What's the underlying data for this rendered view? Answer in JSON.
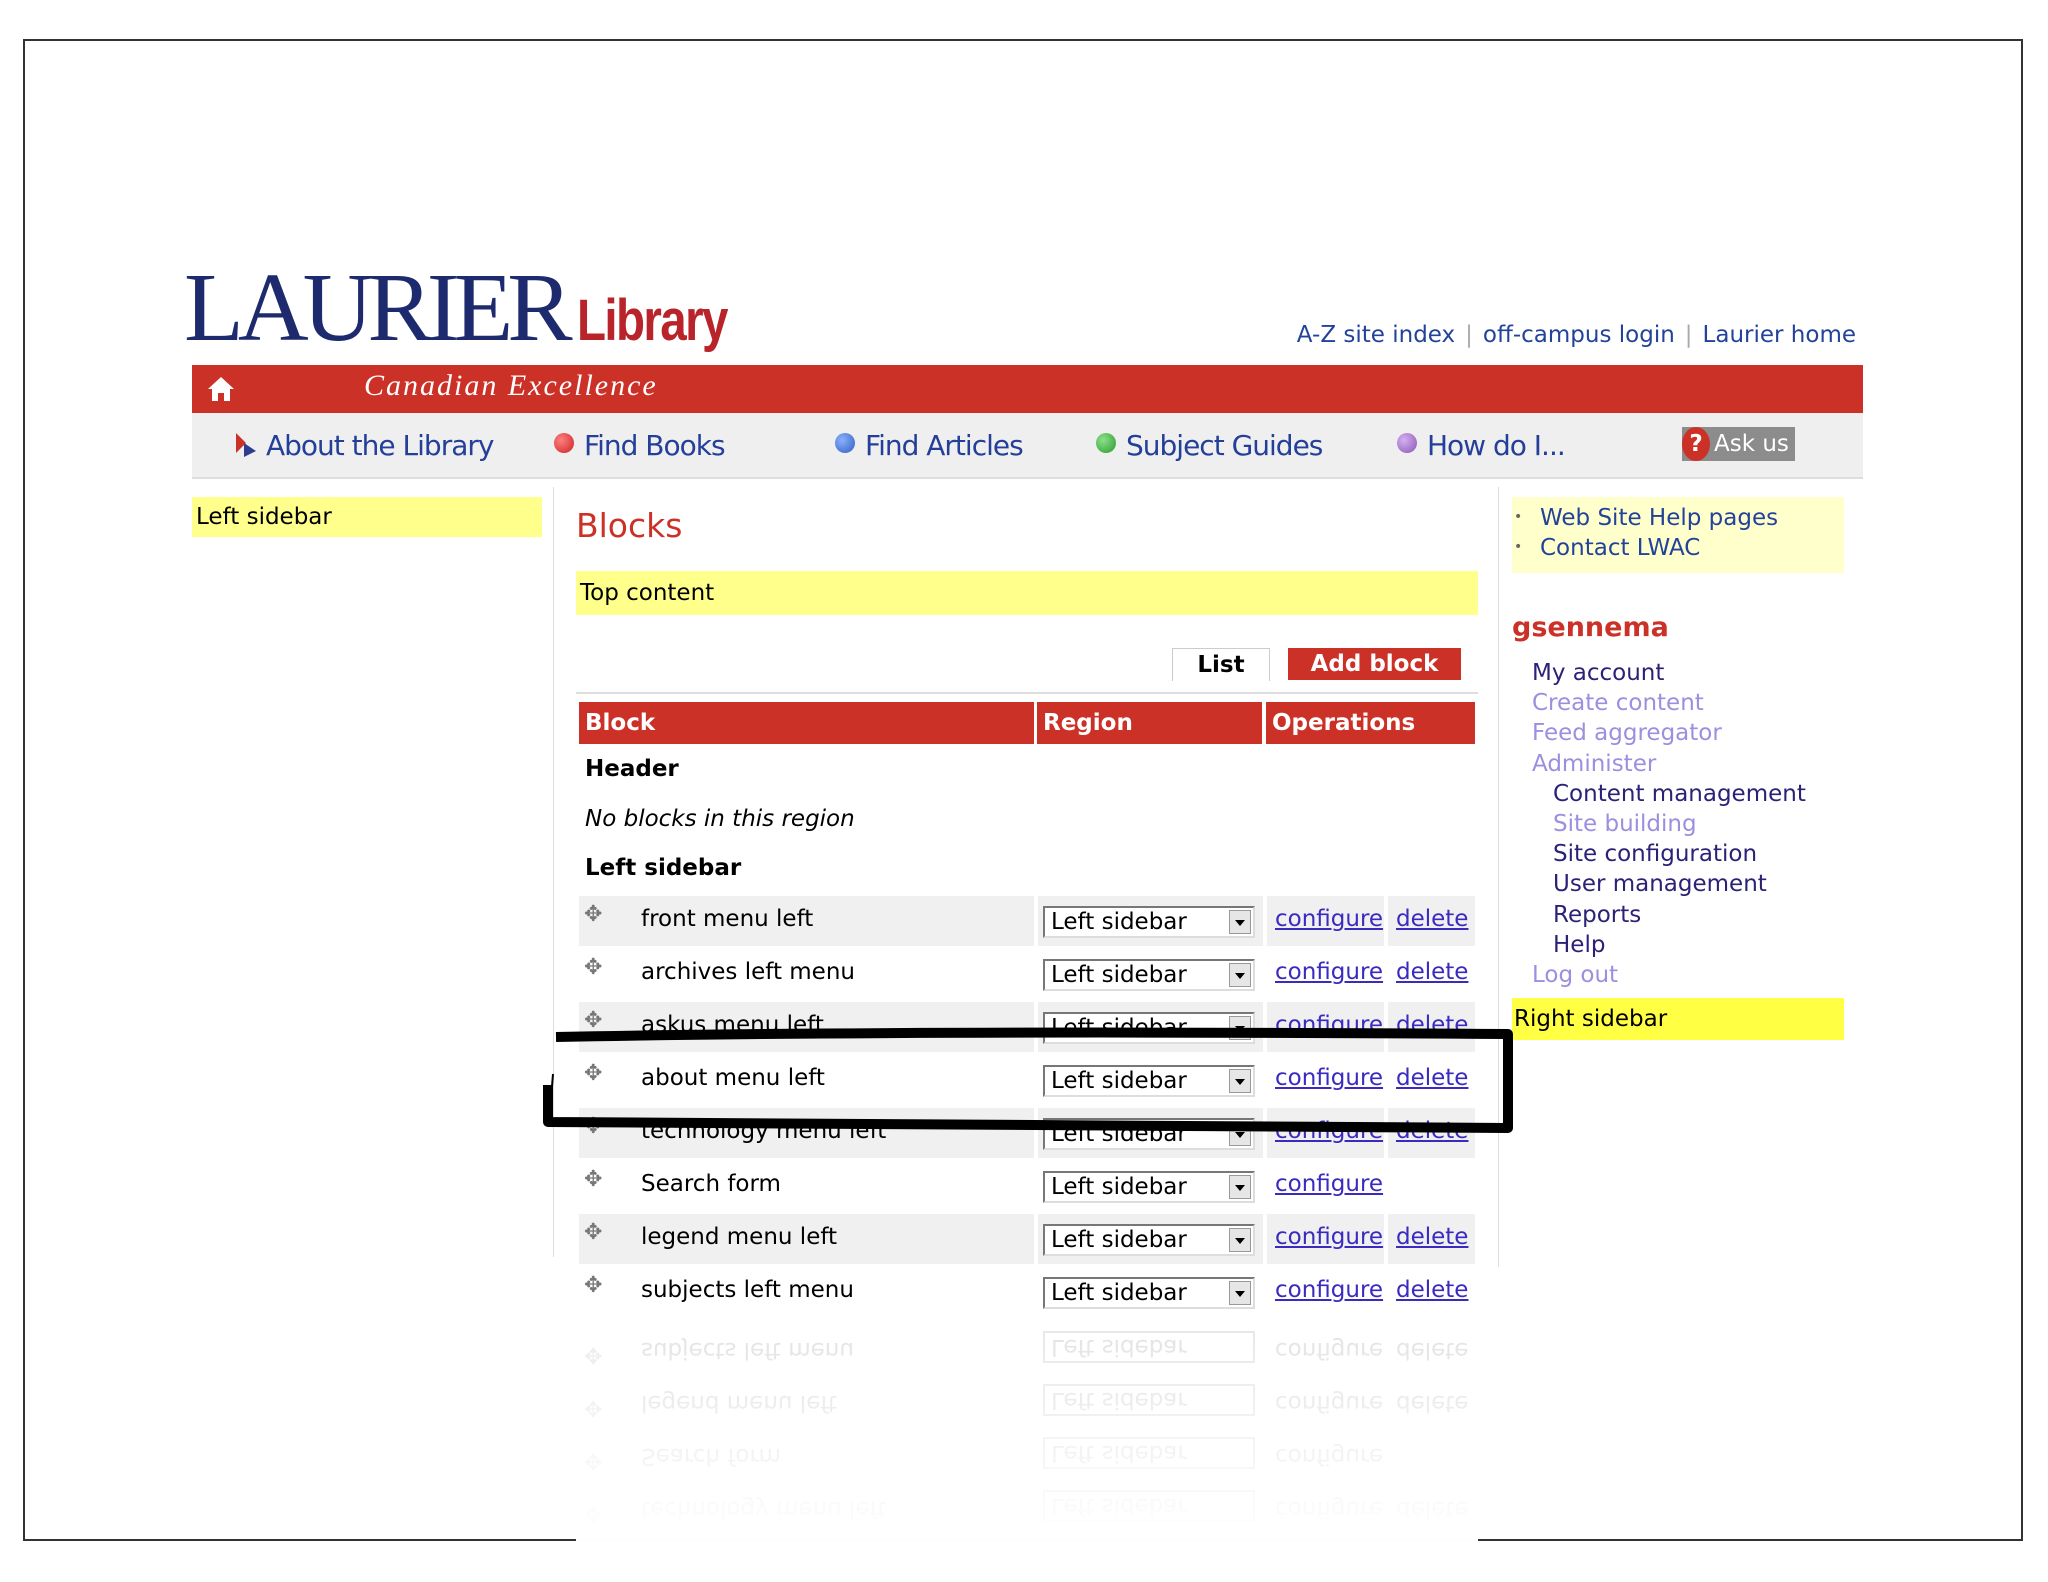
{
  "header": {
    "logo_main": "LAURIER",
    "logo_sub": "Library",
    "tagline": "Canadian Excellence",
    "top_links": [
      "A-Z site index",
      "off-campus login",
      "Laurier home"
    ],
    "top_link_sep": "|"
  },
  "nav": {
    "items": [
      {
        "label": "About the Library",
        "icon": "about-icon",
        "color": "#cc3128"
      },
      {
        "label": "Find Books",
        "icon": "red-dot-icon",
        "color": "#cc2222"
      },
      {
        "label": "Find Articles",
        "icon": "blue-dot-icon",
        "color": "#2f5fc0"
      },
      {
        "label": "Subject Guides",
        "icon": "green-dot-icon",
        "color": "#2a9a2a"
      },
      {
        "label": "How do I...",
        "icon": "purple-dot-icon",
        "color": "#8a55b5"
      }
    ],
    "ask_us": "Ask us",
    "ask_icon": "?"
  },
  "left_sidebar": {
    "region_label": "Left sidebar"
  },
  "main": {
    "title": "Blocks",
    "top_region": "Top content",
    "tabs": {
      "list": "List",
      "add": "Add block"
    },
    "table": {
      "headers": [
        "Block",
        "Region",
        "Operations"
      ],
      "regions": [
        {
          "name": "Header",
          "empty_text": "No blocks in this region"
        },
        {
          "name": "Left sidebar"
        }
      ],
      "rows": [
        {
          "block": "front menu left",
          "region": "Left sidebar",
          "configure": "configure",
          "delete": "delete"
        },
        {
          "block": "archives left menu",
          "region": "Left sidebar",
          "configure": "configure",
          "delete": "delete"
        },
        {
          "block": "askus menu left",
          "region": "Left sidebar",
          "configure": "configure",
          "delete": "delete"
        },
        {
          "block": "about menu left",
          "region": "Left sidebar",
          "configure": "configure",
          "delete": "delete"
        },
        {
          "block": "technology menu left",
          "region": "Left sidebar",
          "configure": "configure",
          "delete": "delete"
        },
        {
          "block": "Search form",
          "region": "Left sidebar",
          "configure": "configure",
          "delete": ""
        },
        {
          "block": "legend menu left",
          "region": "Left sidebar",
          "configure": "configure",
          "delete": "delete"
        },
        {
          "block": "subjects left menu",
          "region": "Left sidebar",
          "configure": "configure",
          "delete": "delete"
        }
      ]
    }
  },
  "right_sidebar": {
    "help_links": [
      "Web Site Help pages",
      "Contact LWAC"
    ],
    "username": "gsennema",
    "menu": [
      {
        "label": "My account",
        "level": 0,
        "visited": false
      },
      {
        "label": "Create content",
        "level": 0,
        "visited": true
      },
      {
        "label": "Feed aggregator",
        "level": 0,
        "visited": true
      },
      {
        "label": "Administer",
        "level": 0,
        "visited": true
      },
      {
        "label": "Content management",
        "level": 1,
        "visited": false
      },
      {
        "label": "Site building",
        "level": 1,
        "visited": true
      },
      {
        "label": "Site configuration",
        "level": 1,
        "visited": false
      },
      {
        "label": "User management",
        "level": 1,
        "visited": false
      },
      {
        "label": "Reports",
        "level": 1,
        "visited": false
      },
      {
        "label": "Help",
        "level": 1,
        "visited": false
      },
      {
        "label": "Log out",
        "level": 0,
        "visited": true
      }
    ],
    "region_label": "Right sidebar"
  },
  "colors": {
    "brand_red": "#cc3128",
    "navy": "#1e2a6e",
    "region_yellow": "#ffff8c",
    "link": "#3a2ac0",
    "menu_link": "#2b2277",
    "menu_visited": "#9b8fe0"
  }
}
